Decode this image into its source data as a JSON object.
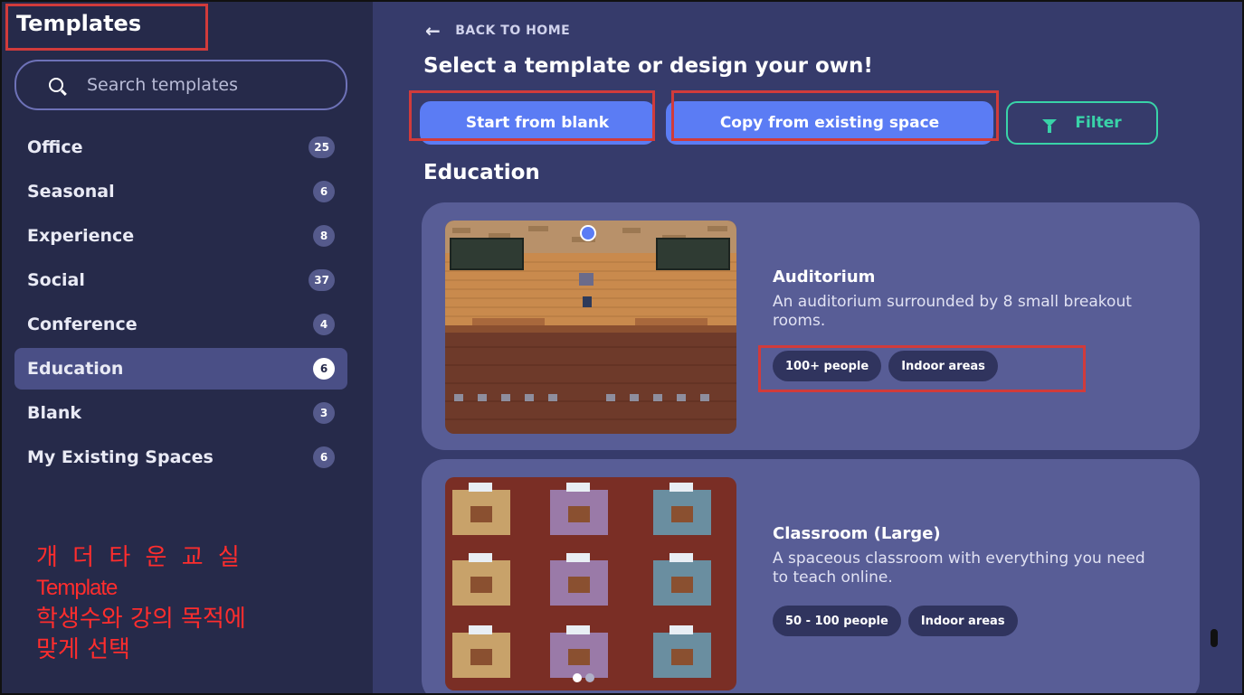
{
  "sidebar": {
    "title": "Templates",
    "search_placeholder": "Search templates",
    "categories": [
      {
        "label": "Office",
        "count": "25"
      },
      {
        "label": "Seasonal",
        "count": "6"
      },
      {
        "label": "Experience",
        "count": "8"
      },
      {
        "label": "Social",
        "count": "37"
      },
      {
        "label": "Conference",
        "count": "4"
      },
      {
        "label": "Education",
        "count": "6"
      },
      {
        "label": "Blank",
        "count": "3"
      },
      {
        "label": "My Existing Spaces",
        "count": "6"
      }
    ],
    "active_category": "Education"
  },
  "annotation": {
    "line1": "개 더 타 운   교 실",
    "line2": "Template",
    "line3": "학생수와 강의 목적에",
    "line4": "맞게 선택"
  },
  "main": {
    "back_label": "BACK TO HOME",
    "heading": "Select a template or design your own!",
    "buttons": {
      "blank": "Start from blank",
      "copy": "Copy from existing space",
      "filter": "Filter"
    },
    "section_title": "Education",
    "templates": [
      {
        "title": "Auditorium",
        "description": "An auditorium surrounded by 8 small breakout rooms.",
        "tags": [
          "100+ people",
          "Indoor areas"
        ]
      },
      {
        "title": "Classroom (Large)",
        "description": "A spaceous classroom with everything you need to teach online.",
        "tags": [
          "50 - 100 people",
          "Indoor areas"
        ]
      }
    ]
  },
  "colors": {
    "sidebar_bg": "#262a4a",
    "main_bg": "#363b6b",
    "card_bg": "#585d96",
    "primary_button": "#5b7cf4",
    "filter_accent": "#39d3a8",
    "highlight": "#d13b3b",
    "annotation_text": "#ff2d2d"
  },
  "icons": [
    "search-icon",
    "back-arrow-icon",
    "filter-icon"
  ]
}
